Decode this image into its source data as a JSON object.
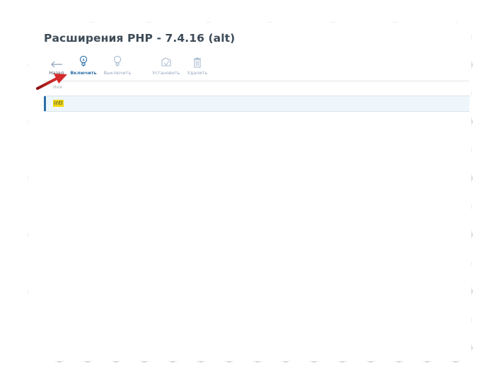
{
  "window": {
    "title": "Расширения PHP - 7.4.16 (alt)"
  },
  "toolbar": {
    "back_label": "Назад",
    "enable_label": "Включить",
    "disable_label": "Выключить",
    "install_label": "Установить",
    "delete_label": "Удалить"
  },
  "table": {
    "header": "Имя",
    "rows": [
      {
        "name": "intl"
      }
    ]
  },
  "colors": {
    "accent": "#2b6fa6",
    "highlight": "#f5d90f",
    "annotation_arrow": "#d42a2a"
  }
}
